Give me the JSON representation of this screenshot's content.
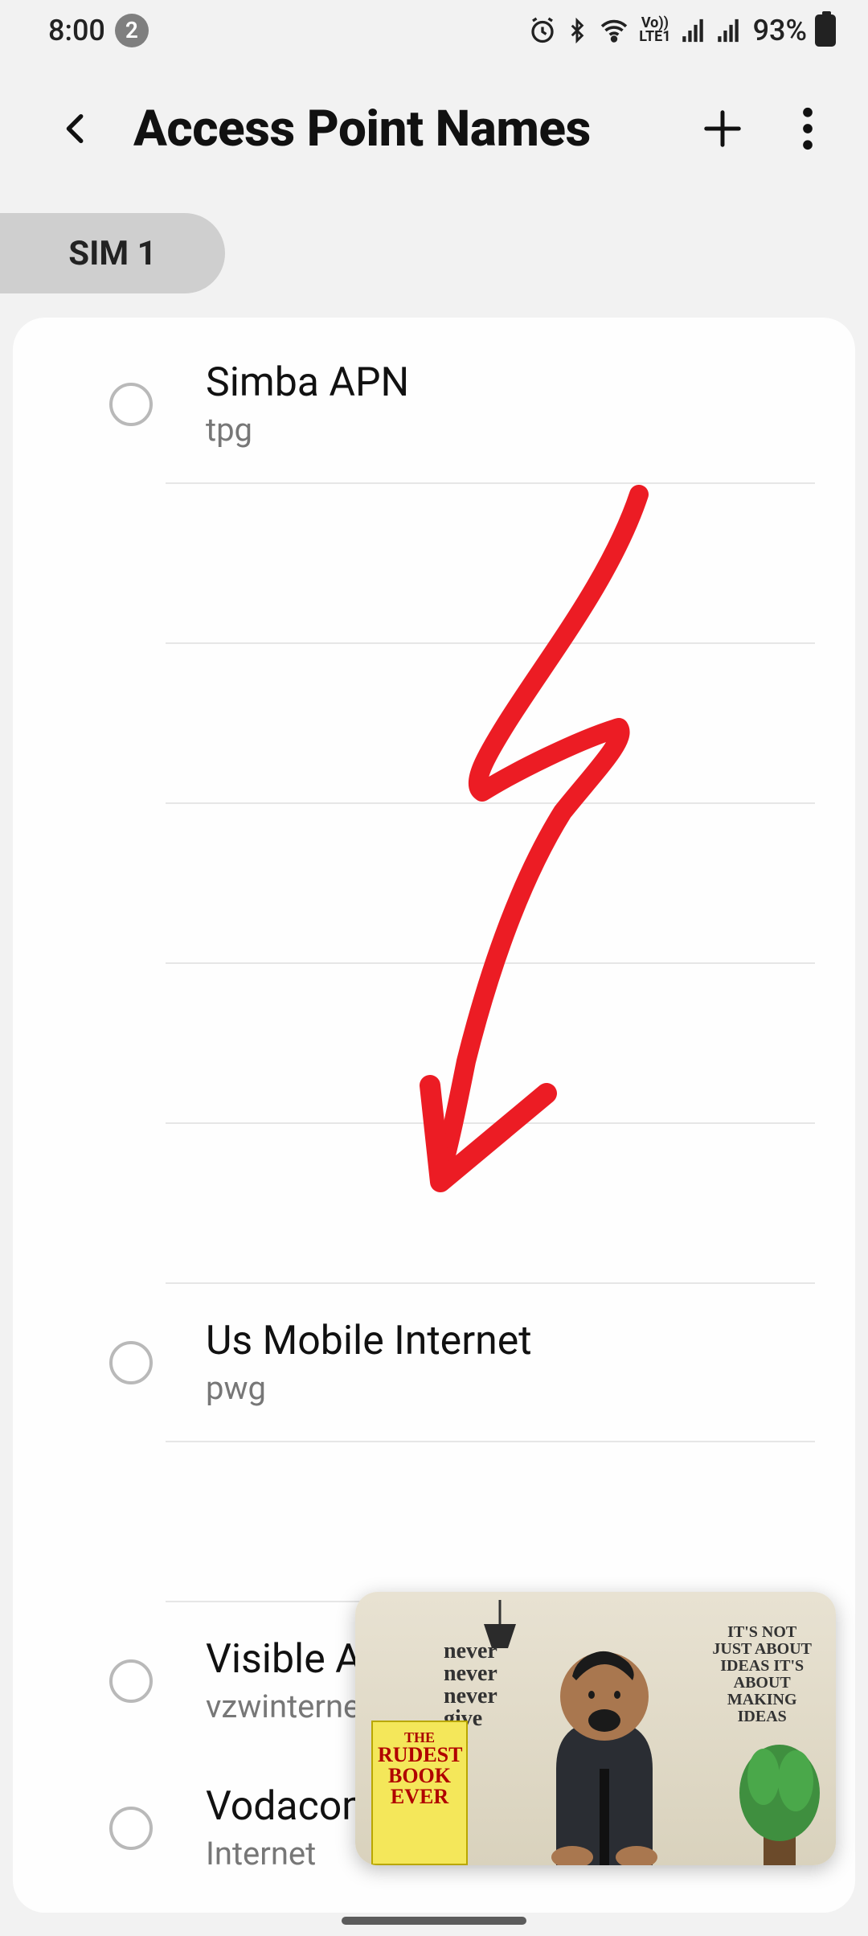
{
  "status": {
    "time": "8:00",
    "notif_count": "2",
    "lte_label": "Vo))\nLTE1",
    "battery_pct": "93%"
  },
  "header": {
    "title": "Access Point Names"
  },
  "tabs": {
    "sim1": "SIM 1"
  },
  "apn_list": [
    {
      "title": "Simba APN",
      "sub": "tpg",
      "blank": false
    },
    {
      "title": "",
      "sub": "",
      "blank": true
    },
    {
      "title": "",
      "sub": "",
      "blank": true
    },
    {
      "title": "",
      "sub": "",
      "blank": true
    },
    {
      "title": "",
      "sub": "",
      "blank": true
    },
    {
      "title": "",
      "sub": "",
      "blank": true
    },
    {
      "title": "Us Mobile Internet",
      "sub": "pwg",
      "blank": false
    },
    {
      "title": "",
      "sub": "",
      "blank": true
    },
    {
      "title": "Visible APN",
      "sub": "vzwinternet",
      "blank": false
    },
    {
      "title": "Vodacom",
      "sub": "Internet",
      "blank": false
    }
  ],
  "annotation": {
    "type": "hand-drawn-arrow",
    "color": "#ec1c24"
  },
  "pip": {
    "wall_text": "never\nnever\nnever\ngive\nup",
    "wall_text_right": "IT'S NOT\nJUST ABOUT\nIDEAS IT'S\nABOUT\nMAKING\nIDEAS",
    "book_lines": [
      "THE",
      "RUDEST",
      "BOOK",
      "EVER"
    ]
  }
}
